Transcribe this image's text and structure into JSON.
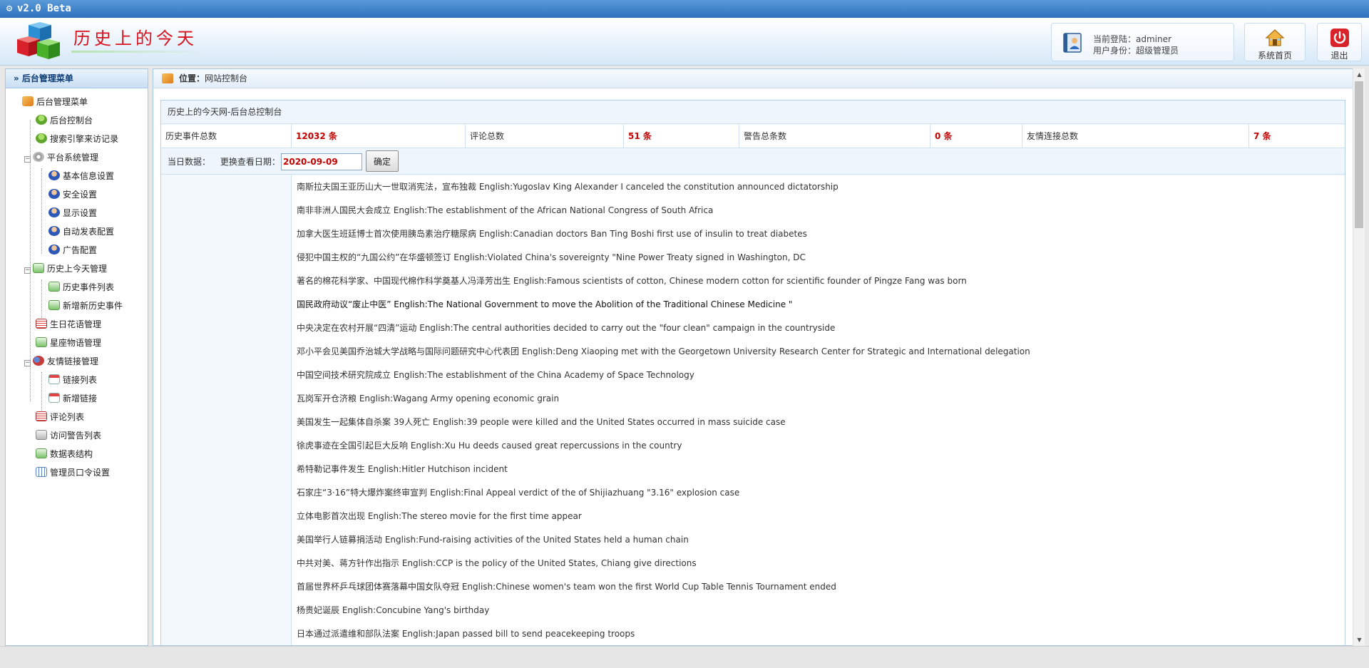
{
  "titlebar": {
    "text": "v2.0 Beta"
  },
  "header": {
    "site_title": "历史上的今天",
    "user": {
      "login_line": "当前登陆：adminer",
      "role_line": "用户身份：超级管理员"
    },
    "home_label": "系统首页",
    "exit_label": "退出"
  },
  "sidebar": {
    "title": "» 后台管理菜单",
    "items": [
      {
        "label": "后台管理菜单",
        "icon": "home-icon"
      },
      {
        "label": "后台控制台",
        "icon": "user-icon"
      },
      {
        "label": "搜索引擎来访记录",
        "icon": "user-icon"
      },
      {
        "label": "平台系统管理",
        "icon": "gear-icon"
      },
      {
        "label": "基本信息设置",
        "icon": "user-icon"
      },
      {
        "label": "安全设置",
        "icon": "user-icon"
      },
      {
        "label": "显示设置",
        "icon": "user-icon"
      },
      {
        "label": "自动发表配置",
        "icon": "user-icon"
      },
      {
        "label": "广告配置",
        "icon": "user-icon"
      },
      {
        "label": "历史上今天管理",
        "icon": "mail-icon"
      },
      {
        "label": "历史事件列表",
        "icon": "mail-icon"
      },
      {
        "label": "新增新历史事件",
        "icon": "mail-icon"
      },
      {
        "label": "生日花语管理",
        "icon": "list-icon"
      },
      {
        "label": "星座物语管理",
        "icon": "mail-icon"
      },
      {
        "label": "友情链接管理",
        "icon": "link-icon"
      },
      {
        "label": "链接列表",
        "icon": "calendar-icon"
      },
      {
        "label": "新增链接",
        "icon": "calendar-icon"
      },
      {
        "label": "评论列表",
        "icon": "list-icon"
      },
      {
        "label": "访问警告列表",
        "icon": "cart-icon"
      },
      {
        "label": "数据表结构",
        "icon": "mail-icon"
      },
      {
        "label": "管理员口令设置",
        "icon": "grid-icon"
      }
    ]
  },
  "location": {
    "label": "位置：",
    "value": "网站控制台"
  },
  "stats": {
    "title": "历史上的今天网-后台总控制台",
    "cells": [
      {
        "label": "历史事件总数",
        "value": "12032 条"
      },
      {
        "label": "评论总数",
        "value": "51 条"
      },
      {
        "label": "警告总条数",
        "value": "0 条"
      },
      {
        "label": "友情连接总数",
        "value": "7 条"
      }
    ]
  },
  "date_row": {
    "label": "当日数据：",
    "change_label": "更换查看日期：",
    "date_value": "2020-09-09",
    "confirm": "确定"
  },
  "events": [
    "南斯拉夫国王亚历山大一世取消宪法，宣布独裁 English:Yugoslav King Alexander I canceled the constitution announced dictatorship",
    "南非非洲人国民大会成立 English:The establishment of the African National Congress of South Africa",
    "加拿大医生班廷博士首次使用胰岛素治疗糖尿病 English:Canadian doctors Ban Ting Boshi first use of insulin to treat diabetes",
    "侵犯中国主权的“九国公约”在华盛顿签订 English:Violated China's sovereignty \"Nine Power Treaty signed in Washington, DC",
    "著名的棉花科学家、中国现代棉作科学奠基人冯泽芳出生 English:Famous scientists of cotton, Chinese modern cotton for scientific founder of Pingze Fang was born",
    "国民政府动议“废止中医” English:The National Government to move the Abolition of the Traditional Chinese Medicine \"",
    "中央决定在农村开展“四清”运动 English:The central authorities decided to carry out the \"four clean\" campaign in the countryside",
    "邓小平会见美国乔治城大学战略与国际问题研究中心代表团 English:Deng Xiaoping met with the Georgetown University Research Center for Strategic and International delegation",
    "中国空间技术研究院成立 English:The establishment of the China Academy of Space Technology",
    "瓦岗军开仓济粮 English:Wagang Army opening economic grain",
    "美国发生一起集体自杀案 39人死亡 English:39 people were killed and the United States occurred in mass suicide case",
    "徐虎事迹在全国引起巨大反响 English:Xu Hu deeds caused great repercussions in the country",
    "希特勒记事件发生 English:Hitler Hutchison incident",
    "石家庄“3·16”特大爆炸案终审宣判 English:Final Appeal verdict of the of Shijiazhuang \"3.16\" explosion case",
    "立体电影首次出现 English:The stereo movie for the first time appear",
    "美国举行人链募捐活动 English:Fund-raising activities of the United States held a human chain",
    "中共对美、蒋方针作出指示 English:CCP is the policy of the United States, Chiang give directions",
    "首届世界杯乒乓球团体赛落幕中国女队夺冠 English:Chinese women's team won the first World Cup Table Tennis Tournament ended",
    "杨贵妃诞辰 English:Concubine Yang's birthday",
    "日本通过派遣维和部队法案 English:Japan passed bill to send peacekeeping troops"
  ],
  "colors": {
    "accent": "#2e72bd",
    "value_red": "#c40000",
    "title_red": "#d7121f"
  }
}
